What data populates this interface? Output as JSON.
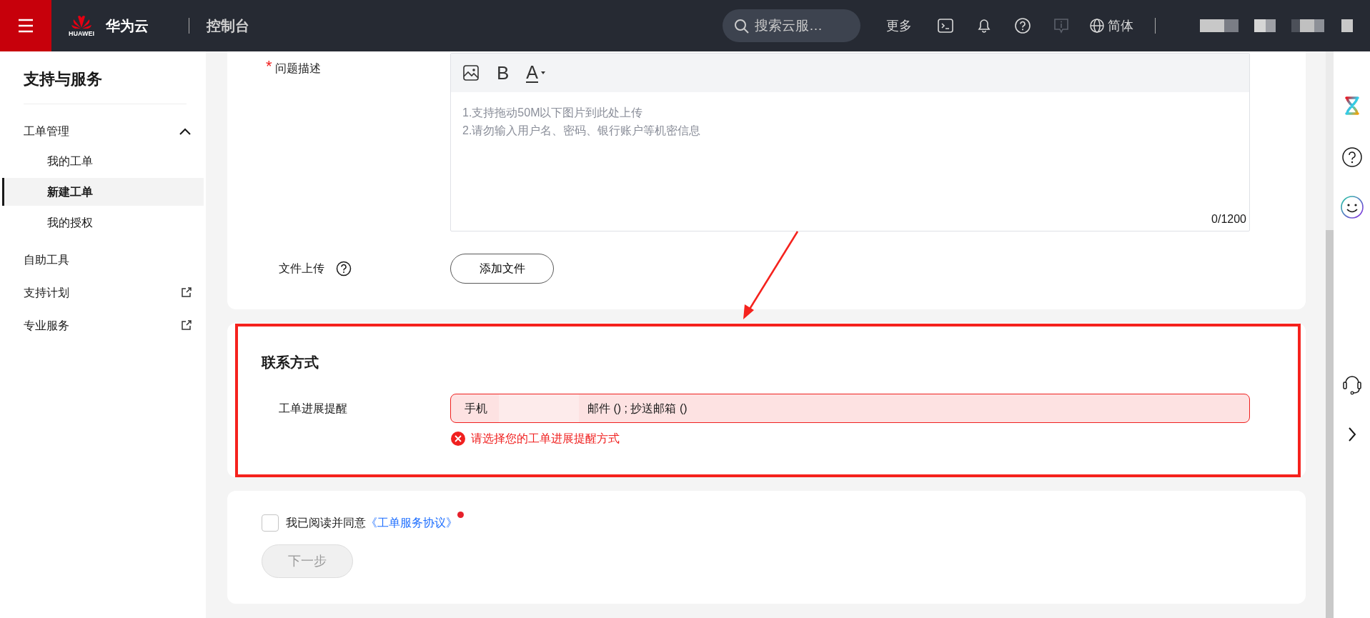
{
  "topbar": {
    "logo_text": "HUAWEI",
    "brand": "华为云",
    "console": "控制台",
    "search": {
      "placeholder": "搜索云服…"
    },
    "more": "更多",
    "tools": [
      {
        "kind": "terminal",
        "disabled": false
      },
      {
        "kind": "bell",
        "disabled": false
      },
      {
        "kind": "help",
        "disabled": false
      },
      {
        "kind": "info",
        "disabled": true
      }
    ],
    "language": {
      "label": "简体",
      "disabled": false
    }
  },
  "sidebar": {
    "title": "支持与服务",
    "items": [
      {
        "label": "工单管理",
        "selected": false,
        "external": false,
        "expanded": true,
        "children": [
          {
            "label": "我的工单",
            "selected": false
          },
          {
            "label": "新建工单",
            "selected": true
          },
          {
            "label": "我的授权",
            "selected": false
          }
        ]
      },
      {
        "label": "自助工具",
        "selected": false,
        "external": false
      },
      {
        "label": "支持计划",
        "selected": false,
        "external": true
      },
      {
        "label": "专业服务",
        "selected": false,
        "external": true
      }
    ]
  },
  "description": {
    "required_mark": "*",
    "label": "问题描述",
    "toolbar": [
      {
        "kind": "image"
      },
      {
        "kind": "bold",
        "glyph": "B"
      },
      {
        "kind": "color",
        "glyph": "A"
      }
    ],
    "placeholder": "1.支持拖动50M以下图片到此处上传\n2.请勿输入用户名、密码、银行账户等机密信息",
    "counter": "0/1200"
  },
  "upload": {
    "label": "文件上传",
    "button": "添加文件"
  },
  "contact": {
    "title": "联系方式",
    "reminder": {
      "label": "工单进展提醒",
      "value_start": "手机",
      "value_end": "邮件 () ; 抄送邮箱 ()",
      "invalid": true,
      "error": "请选择您的工单进展提醒方式"
    }
  },
  "agreement": {
    "checked": false,
    "text": "我已阅读并同意",
    "link": "《工单服务协议》",
    "required_dot": true
  },
  "next_button": {
    "label": "下一步",
    "disabled": true
  }
}
